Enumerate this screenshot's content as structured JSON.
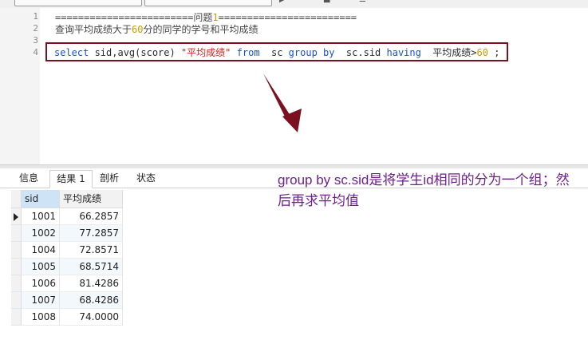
{
  "editor": {
    "line_numbers": [
      "1",
      "2",
      "3",
      "4"
    ],
    "line1_prefix": "========================问题",
    "line1_num": "1",
    "line1_suffix": "========================",
    "line2_prefix": "查询平均成绩大于",
    "line2_num": "60",
    "line2_suffix": "分的同学的学号和平均成绩",
    "sql": {
      "t1": "select",
      "t2": " sid,avg(score) ",
      "t3": "\"平均成绩\"",
      "t4": " ",
      "t5": "from",
      "t6": "  sc ",
      "t7": "group by",
      "t8": "  sc.sid ",
      "t9": "having",
      "t10": "  平均成绩>",
      "t11": "60",
      "t12": " ;"
    }
  },
  "tabs": [
    {
      "label": "信息"
    },
    {
      "label": "结果 1"
    },
    {
      "label": "剖析"
    },
    {
      "label": "状态"
    }
  ],
  "active_tab_index": 1,
  "grid": {
    "columns": [
      "sid",
      "平均成绩"
    ],
    "rows": [
      [
        "1001",
        "66.2857"
      ],
      [
        "1002",
        "77.2857"
      ],
      [
        "1004",
        "72.8571"
      ],
      [
        "1005",
        "68.5714"
      ],
      [
        "1006",
        "81.4286"
      ],
      [
        "1007",
        "68.4286"
      ],
      [
        "1008",
        "74.0000"
      ]
    ]
  },
  "annotation": "group by sc.sid是将学生id相同的分为一个组；然后再求平均值",
  "colors": {
    "highlight_box": "#7a1020",
    "arrow": "#7a1020",
    "annotation": "#6e1f8c",
    "keyword": "#1a4fd6",
    "string": "#d0231d"
  }
}
